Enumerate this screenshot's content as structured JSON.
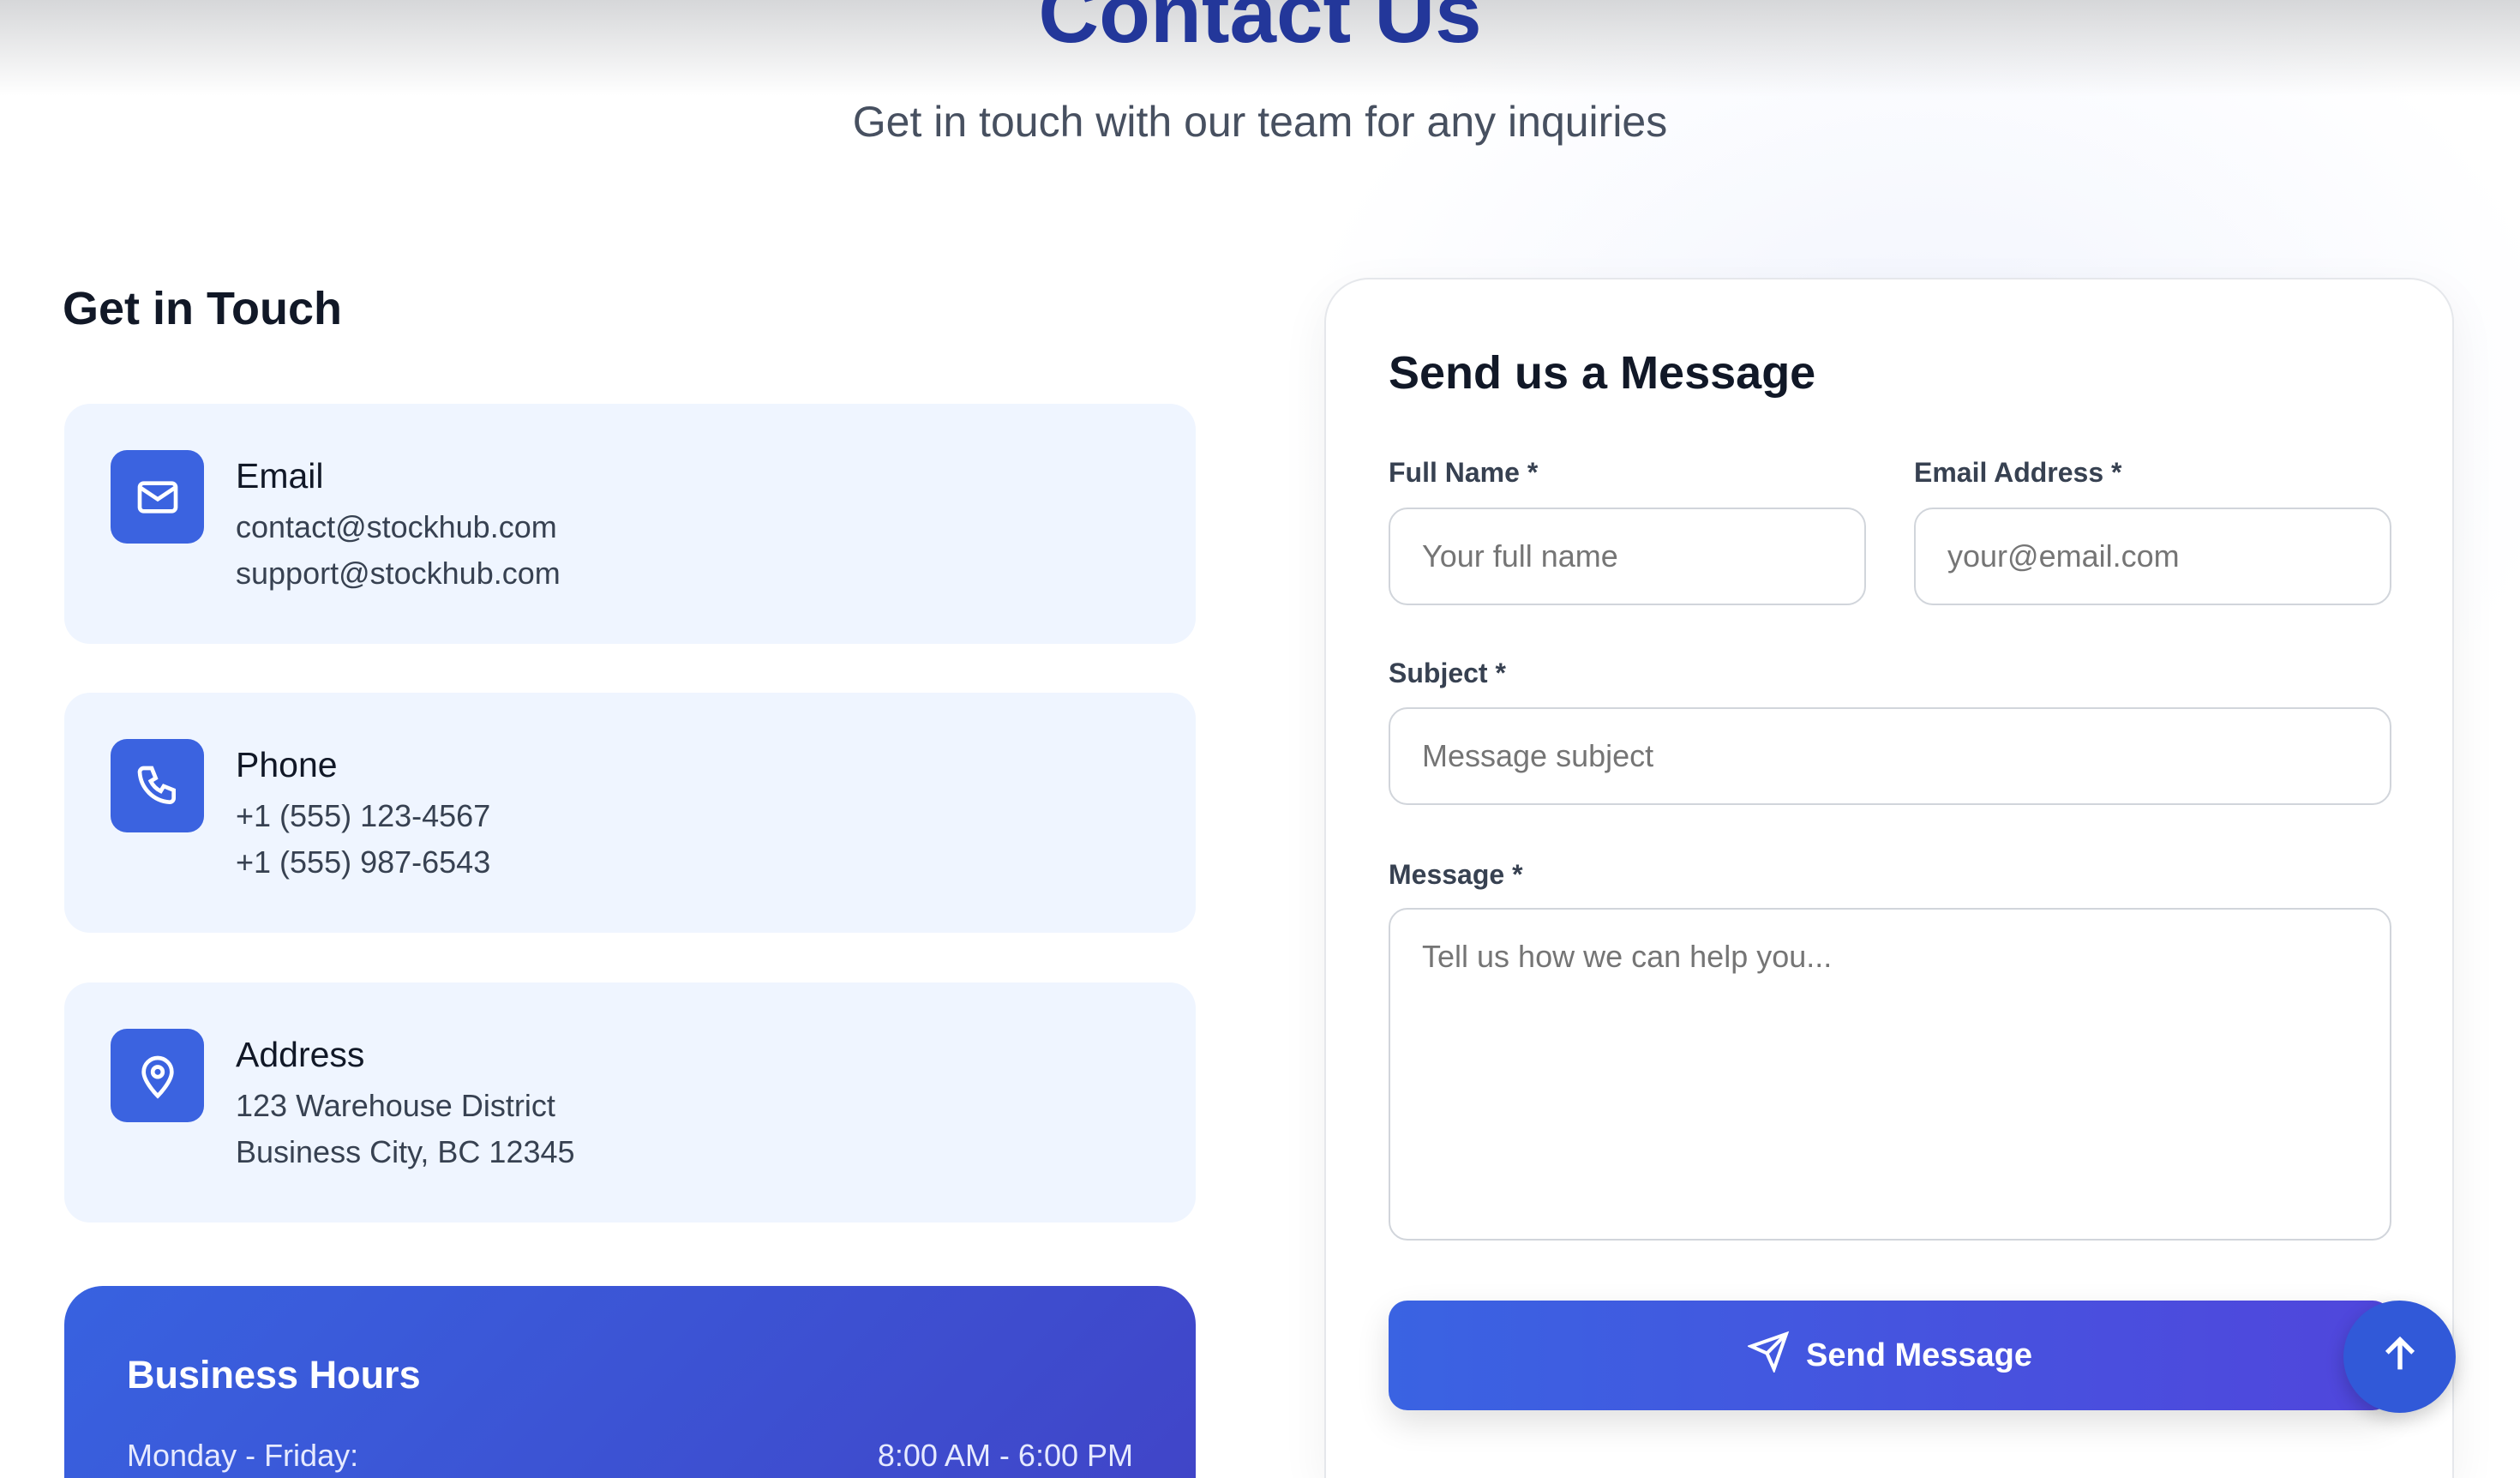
{
  "header": {
    "title": "Contact Us",
    "subtitle": "Get in touch with our team for any inquiries"
  },
  "contact_info": {
    "heading": "Get in Touch",
    "cards": [
      {
        "icon": "mail-icon",
        "title": "Email",
        "lines": [
          "contact@stockhub.com",
          "support@stockhub.com"
        ]
      },
      {
        "icon": "phone-icon",
        "title": "Phone",
        "lines": [
          "+1 (555) 123-4567",
          "+1 (555) 987-6543"
        ]
      },
      {
        "icon": "map-pin-icon",
        "title": "Address",
        "lines": [
          "123 Warehouse District",
          "Business City, BC 12345"
        ]
      }
    ],
    "business_hours": {
      "title": "Business Hours",
      "rows": [
        {
          "day": "Monday - Friday:",
          "time": "8:00 AM - 6:00 PM"
        }
      ]
    }
  },
  "form": {
    "heading": "Send us a Message",
    "full_name": {
      "label": "Full Name *",
      "placeholder": "Your full name",
      "value": ""
    },
    "email": {
      "label": "Email Address *",
      "placeholder": "your@email.com",
      "value": ""
    },
    "subject": {
      "label": "Subject *",
      "placeholder": "Message subject",
      "value": ""
    },
    "message": {
      "label": "Message *",
      "placeholder": "Tell us how we can help you...",
      "value": ""
    },
    "submit_label": "Send Message"
  },
  "colors": {
    "accent": "#3b63e0",
    "title": "#23379a",
    "card_bg": "#eff5ff"
  }
}
